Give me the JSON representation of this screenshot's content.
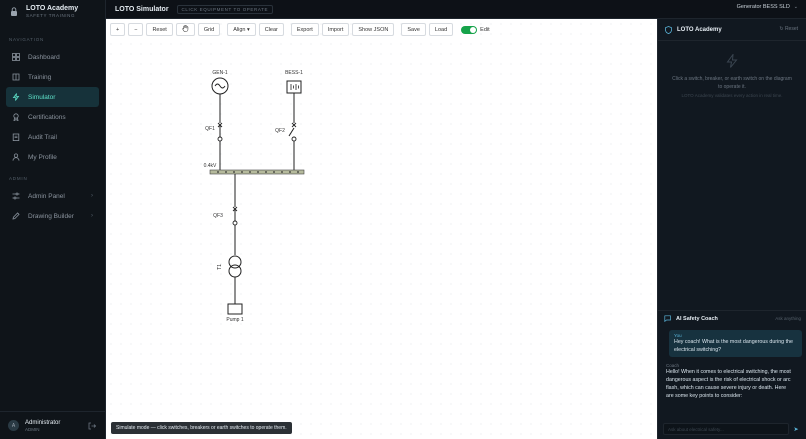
{
  "brand": {
    "name": "LOTO Academy",
    "tagline": "SAFETY TRAINING"
  },
  "sidebar": {
    "nav_label": "NAVIGATION",
    "items": [
      {
        "label": "Dashboard",
        "icon": "grid-icon"
      },
      {
        "label": "Training",
        "icon": "book-icon"
      },
      {
        "label": "Simulator",
        "icon": "zap-icon",
        "active": true
      },
      {
        "label": "Certifications",
        "icon": "award-icon"
      },
      {
        "label": "Audit Trail",
        "icon": "clipboard-icon"
      },
      {
        "label": "My Profile",
        "icon": "user-icon"
      }
    ],
    "admin_label": "ADMIN",
    "admin_items": [
      {
        "label": "Admin Panel",
        "icon": "sliders-icon"
      },
      {
        "label": "Drawing Builder",
        "icon": "pencil-icon"
      }
    ]
  },
  "user": {
    "name": "Administrator",
    "role": "ADMIN",
    "initial": "A"
  },
  "header": {
    "title": "LOTO Simulator",
    "hint": "CLICK EQUIPMENT TO OPERATE",
    "diagram_select": "Generator BESS SLD"
  },
  "toolbar": {
    "zoom_in": "+",
    "zoom_out": "−",
    "reset": "Reset",
    "grid": "Grid",
    "align": "Align ▾",
    "clear": "Clear",
    "export": "Export",
    "import": "Import",
    "show_json": "Show JSON",
    "save": "Save",
    "load": "Load",
    "edit": "Edit",
    "edit_enabled": true
  },
  "diagram": {
    "gen_label": "GEN-1",
    "bess_label": "BESS-1",
    "qf1": "QF1",
    "qf2": "QF2",
    "qf3": "QF3",
    "bus_label": "0.4kV",
    "tx_label": "T1",
    "load_label": "Pump 1"
  },
  "status_toast": "Simulate mode — click switches, breakers or earth switches to operate them.",
  "panel": {
    "title": "LOTO Academy",
    "reset": "Reset",
    "empty_line1": "Click a switch, breaker, or earth switch on the diagram to operate it.",
    "empty_line2": "LOTO Academy validates every action in real time."
  },
  "coach": {
    "title": "AI Safety Coach",
    "ask": "Ask anything",
    "user_who": "You",
    "user_msg": "Hey coach! What is the most dangerous during the electrical switching?",
    "coach_who": "Coach",
    "coach_msg": "Hello! When it comes to electrical switching, the most dangerous aspect is the risk of electrical shock or arc flash, which can cause severe injury or death. Here are some key points to consider:",
    "input_placeholder": "Ask about electrical safety..."
  },
  "colors": {
    "accent": "#5ee0c8",
    "bus": "#b5ba9c",
    "toggle_on": "#16a34a"
  }
}
